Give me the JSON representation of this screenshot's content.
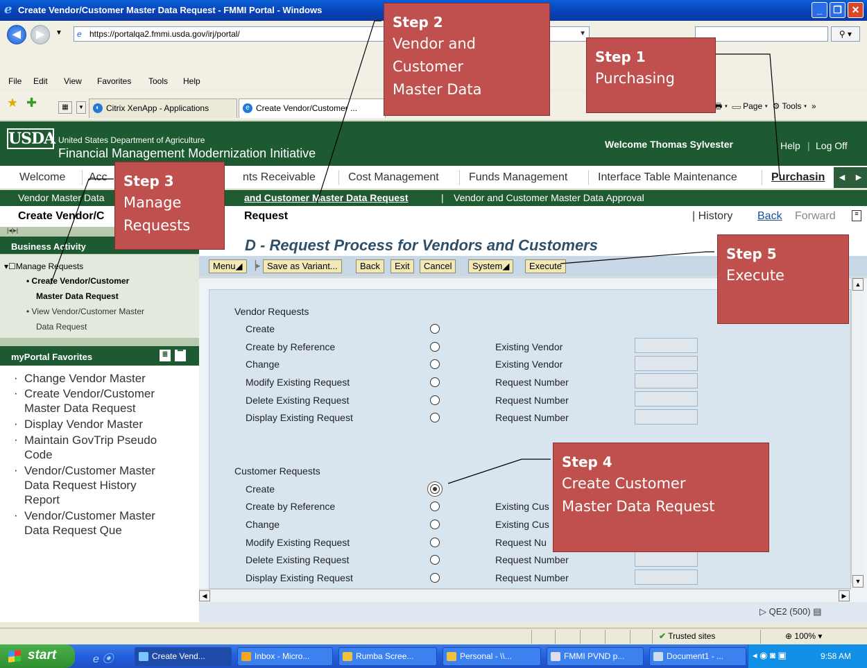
{
  "window": {
    "title": "Create Vendor/Customer Master Data Request - FMMI Portal - Windows"
  },
  "browser": {
    "url": "https://portalqa2.fmmi.usda.gov/irj/portal/",
    "menu": [
      "File",
      "Edit",
      "View",
      "Favorites",
      "Tools",
      "Help"
    ],
    "tabs": [
      "Citrix XenApp - Applications",
      "Create Vendor/Customer ..."
    ],
    "command_bar": [
      "Page",
      "Tools"
    ]
  },
  "portal": {
    "logo": "USDA",
    "dept": "United States Department of Agriculture",
    "initiative": "Financial Management Modernization Initiative",
    "welcome": "Welcome Thomas Sylvester",
    "help": "Help",
    "logoff": "Log Off",
    "top_nav": [
      "Welcome",
      "Acc",
      "nts Receivable",
      "Cost Management",
      "Funds Management",
      "Interface Table Maintenance",
      "Purchasin"
    ],
    "sub_nav": [
      "Vendor Master Data",
      "and Customer Master Data Request",
      "|",
      "Vendor and Customer Master Data Approval"
    ],
    "page_title_left": "Create Vendor/C",
    "page_title_right": "Request",
    "history": "| History",
    "back": "Back",
    "forward": "Forward"
  },
  "left_nav": {
    "business_activity": "Business Activity",
    "manage_requests": "Manage Requests",
    "item1_line1": "• Create Vendor/Customer",
    "item1_line2": "Master Data Request",
    "item2_line1": "• View Vendor/Customer Master",
    "item2_line2": "Data Request",
    "favorites_title": "myPortal Favorites",
    "favorites": [
      [
        "Change Vendor Master"
      ],
      [
        "Create Vendor/Customer",
        "Master Data Request"
      ],
      [
        "Display Vendor Master"
      ],
      [
        "Maintain GovTrip Pseudo",
        "Code"
      ],
      [
        "Vendor/Customer Master",
        "Data Request History",
        "Report"
      ],
      [
        "Vendor/Customer Master",
        "Data Request Que"
      ]
    ]
  },
  "sap": {
    "heading": "D - Request Process for Vendors and Customers",
    "toolbar": [
      "Menu",
      "Save as Variant...",
      "Back",
      "Exit",
      "Cancel",
      "System",
      "Execute"
    ],
    "vendor_section": "Vendor Requests",
    "customer_section": "Customer Requests",
    "vendor_rows": [
      {
        "label": "Create",
        "field_label": ""
      },
      {
        "label": "Create by Reference",
        "field_label": "Existing Vendor"
      },
      {
        "label": "Change",
        "field_label": "Existing Vendor"
      },
      {
        "label": "Modify Existing Request",
        "field_label": "Request Number"
      },
      {
        "label": "Delete Existing Request",
        "field_label": "Request Number"
      },
      {
        "label": "Display Existing Request",
        "field_label": "Request Number"
      }
    ],
    "customer_rows": [
      {
        "label": "Create",
        "field_label": "",
        "selected": true
      },
      {
        "label": "Create by Reference",
        "field_label": "Existing Cus"
      },
      {
        "label": "Change",
        "field_label": "Existing Cus"
      },
      {
        "label": "Modify Existing Request",
        "field_label": "Request Nu"
      },
      {
        "label": "Delete Existing Request",
        "field_label": "Request Number"
      },
      {
        "label": "Display Existing Request",
        "field_label": "Request Number"
      }
    ],
    "system_status": "QE2 (500)"
  },
  "ie_status": {
    "zone": "Trusted sites",
    "zoom": "100%"
  },
  "taskbar": {
    "start": "start",
    "tasks": [
      "Create Vend...",
      "Inbox - Micro...",
      "Rumba Scree...",
      "Personal - \\\\...",
      "FMMI PVND p...",
      "Document1 - ..."
    ],
    "clock": "9:58 AM"
  },
  "annotations": [
    {
      "title": "Step 1",
      "desc": [
        "Purchasing"
      ]
    },
    {
      "title": "Step 2",
      "desc": [
        "Vendor and",
        "Customer",
        "Master Data"
      ]
    },
    {
      "title": "Step 3",
      "desc": [
        "Manage",
        "Requests"
      ]
    },
    {
      "title": "Step 4",
      "desc": [
        "Create Customer",
        "Master Data Request"
      ]
    },
    {
      "title": "Step 5",
      "desc": [
        "Execute"
      ]
    }
  ],
  "colors": {
    "annotation": "#c0504d",
    "portal_green": "#1d5a32",
    "sap_button": "#f2e8b8"
  }
}
